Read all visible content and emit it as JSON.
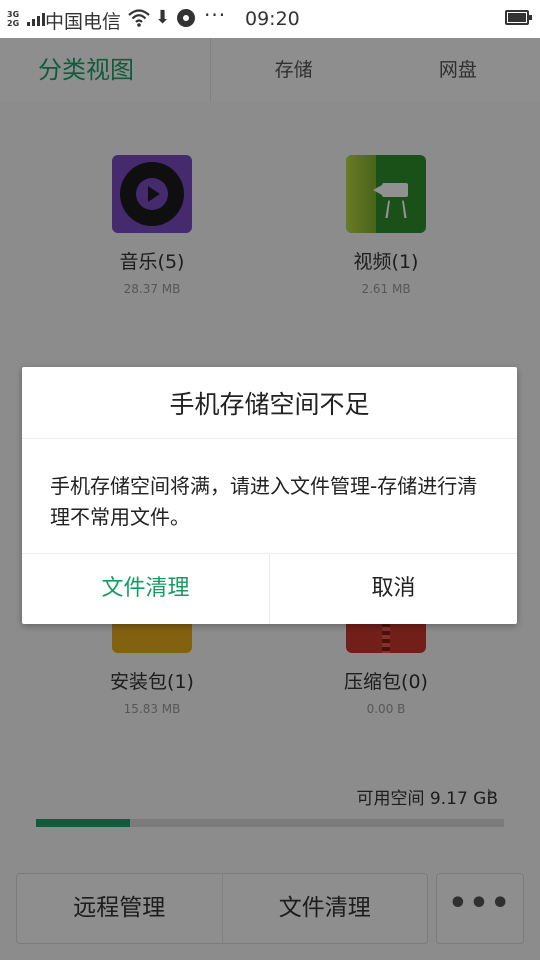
{
  "status_bar": {
    "network_top": "3G",
    "network_bottom": "2G",
    "carrier": "中国电信",
    "download_glyph": "⬇",
    "more_glyph": "···",
    "time": "09:20"
  },
  "tabs": [
    {
      "label": "分类视图",
      "active": true
    },
    {
      "label": "存储",
      "active": false
    },
    {
      "label": "网盘",
      "active": false
    }
  ],
  "categories": [
    {
      "name": "音乐(5)",
      "size": "28.37 MB",
      "icon": "music-icon"
    },
    {
      "name": "视频(1)",
      "size": "2.61 MB",
      "icon": "video-icon"
    },
    {
      "name": "安装包(1)",
      "size": "15.83 MB",
      "icon": "apk-icon"
    },
    {
      "name": "压缩包(0)",
      "size": "0.00 B",
      "icon": "zip-icon"
    }
  ],
  "storage": {
    "label": "可用空间 9.17 GB",
    "chevron": "›",
    "used_fraction": 0.2
  },
  "bottom_bar": {
    "remote_manage": "远程管理",
    "file_clean": "文件清理",
    "more": "•••"
  },
  "dialog": {
    "title": "手机存储空间不足",
    "message": "手机存储空间将满，请进入文件管理-存储进行清理不常用文件。",
    "confirm_label": "文件清理",
    "cancel_label": "取消"
  },
  "colors": {
    "accent": "#1aa36a",
    "dim_overlay": "rgba(0,0,0,0.43)"
  }
}
